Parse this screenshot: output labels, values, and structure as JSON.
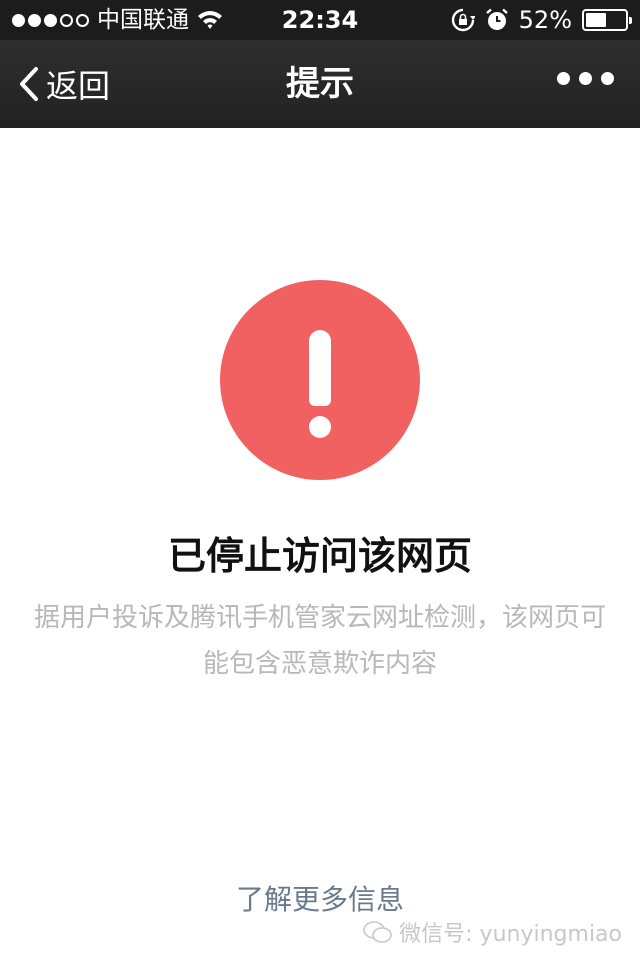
{
  "status_bar": {
    "carrier": "中国联通",
    "time": "22:34",
    "battery_percent_label": "52%",
    "battery_level": 0.52
  },
  "nav": {
    "back_label": "返回",
    "title": "提示"
  },
  "content": {
    "headline": "已停止访问该网页",
    "description": "据用户投诉及腾讯手机管家云网址检测，该网页可能包含恶意欺诈内容",
    "more_link": "了解更多信息"
  },
  "watermark": {
    "text": "微信号: yunyingmiao"
  },
  "colors": {
    "warning": "#f26161",
    "bar_bg": "#1c1c1c",
    "link": "#6a7a8c"
  },
  "icons": [
    "signal-dots-icon",
    "wifi-icon",
    "rotation-lock-icon",
    "alarm-icon",
    "battery-icon",
    "back-chevron-icon",
    "more-dots-icon",
    "exclamation-icon",
    "wechat-logo-icon"
  ]
}
